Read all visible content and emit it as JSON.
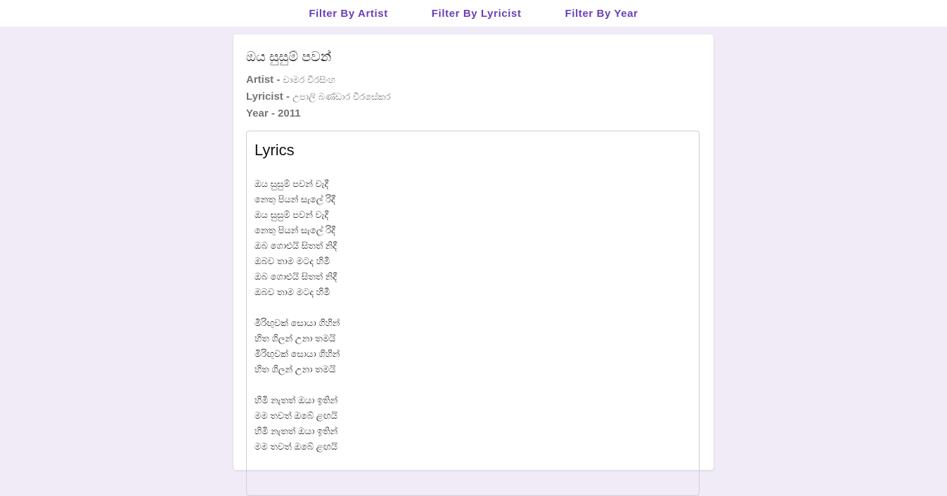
{
  "nav": {
    "artist_label": "Filter By Artist",
    "lyricist_label": "Filter By Lyricist",
    "year_label": "Filter By Year"
  },
  "song": {
    "title": "ඔය සුසුම් පවන්",
    "artist_key": "Artist - ",
    "artist": "චාමර වීරසිංහ",
    "lyricist_key": "Lyricist - ",
    "lyricist": "උපාලි බණ්ඩාර වීරසේකර",
    "year_key": "Year - ",
    "year": "2011"
  },
  "lyrics": {
    "heading": "Lyrics",
    "lines": [
      "ඔය සුසුම් පවන් වැදී",
      "නෙතු පියන් සැලේ රිදී",
      "ඔය සුසුම් පවන් වැදී",
      "නෙතු පියන් සැලේ රිදී",
      "ඔබ ගොළුයි සිතත් නිදී",
      "ඔබව තාම මටද හිමී",
      "ඔබ ගොළුයි සිතත් නිදී",
      "ඔබව තාම මටද හිමී",
      "",
      "මිරිඟුවක් සොයා ගිහින්",
      "හිත ගිලන් උනා තමයි",
      "මිරිඟුවක් සොයා ගිහින්",
      "හිත ගිලන් උනා තමයි",
      "",
      "හිමි නැතත් ඔයා ඉතින්",
      "මම තවත් ඔබේ ළඟයි",
      "හිමි නැතත් ඔයා ඉතින්",
      "මම තවත් ඔබේ ළඟයි"
    ]
  }
}
